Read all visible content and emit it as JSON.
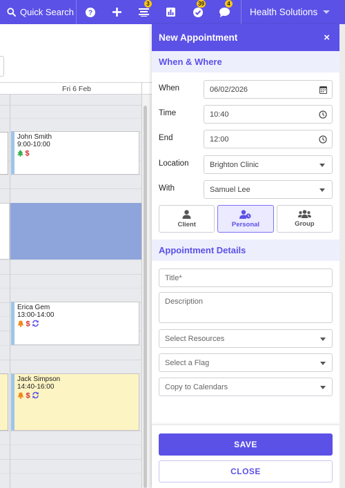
{
  "topbar": {
    "search_label": "Quick Search",
    "org_name": "Health Solutions",
    "icons": [
      {
        "name": "help-icon",
        "badge": ""
      },
      {
        "name": "plus-icon",
        "badge": ""
      },
      {
        "name": "list-icon",
        "badge": "3"
      },
      {
        "name": "chart-icon",
        "badge": ""
      },
      {
        "name": "check-circle-icon",
        "badge": "39"
      },
      {
        "name": "chat-icon",
        "badge": "4"
      }
    ],
    "colors": {
      "accent": "#5b51e6",
      "badge": "#f5c518"
    }
  },
  "calendar": {
    "day_header": "Fri 6 Feb",
    "appointments": [
      {
        "name": "John Smith",
        "time": "9:00-10:00",
        "icons": [
          "tree-icon",
          "dollar-icon"
        ]
      },
      {
        "name": "Erica Gem",
        "time": "13:00-14:00",
        "icons": [
          "bell-icon",
          "dollar-icon",
          "repeat-icon"
        ]
      },
      {
        "name": "Jack Simpson",
        "time": "14:40-16:00",
        "icons": [
          "bell-icon",
          "dollar-icon",
          "repeat-icon"
        ]
      }
    ],
    "colors": {
      "blocked": "#8ea5dc",
      "highlight": "#fdf4c4",
      "event_edge": "#9ec4ea"
    }
  },
  "panel": {
    "title": "New Appointment",
    "close_glyph": "×",
    "section_when": "When & Where",
    "when_label": "When",
    "when_value": "06/02/2026",
    "time_label": "Time",
    "time_value": "10:40",
    "end_label": "End",
    "end_value": "12:00",
    "location_label": "Location",
    "location_value": "Brighton Clinic",
    "with_label": "With",
    "with_value": "Samuel Lee",
    "types": [
      {
        "label": "Client",
        "icon": "user-icon",
        "active": false
      },
      {
        "label": "Personal",
        "icon": "user-clock-icon",
        "active": true
      },
      {
        "label": "Group",
        "icon": "users-icon",
        "active": false
      }
    ],
    "section_details": "Appointment Details",
    "title_placeholder": "Title*",
    "description_placeholder": "Description",
    "resources_placeholder": "Select Resources",
    "flag_placeholder": "Select a Flag",
    "copy_placeholder": "Copy to Calendars",
    "save_label": "SAVE",
    "close_label": "CLOSE"
  }
}
